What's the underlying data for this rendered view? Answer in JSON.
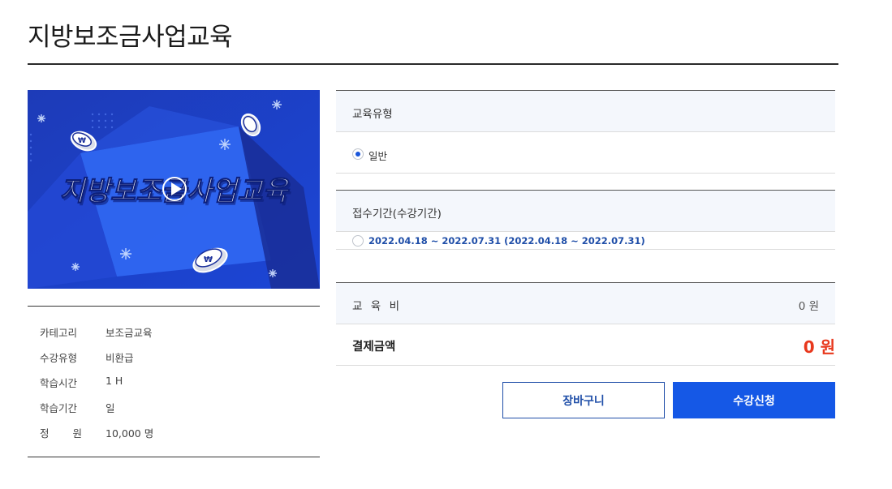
{
  "page": {
    "title": "지방보조금사업교육"
  },
  "thumbnail": {
    "banner_text": "지방보조금사업교육",
    "coin_symbol": "₩"
  },
  "info": {
    "rows": [
      {
        "label": "카테고리",
        "value": "보조금교육"
      },
      {
        "label": "수강유형",
        "value": "비환급"
      },
      {
        "label": "학습시간",
        "value": "1 H"
      },
      {
        "label": "학습기간",
        "value": "일"
      },
      {
        "label_chars": [
          "정",
          "원"
        ],
        "value": "10,000 명"
      }
    ]
  },
  "education_type": {
    "header": "교육유형",
    "options": [
      {
        "label": "일반",
        "checked": true
      }
    ]
  },
  "registration_period": {
    "header": "접수기간(수강기간)",
    "options": [
      {
        "label": "2022.04.18 ~ 2022.07.31 (2022.04.18 ~ 2022.07.31)",
        "checked": false
      }
    ]
  },
  "fee": {
    "label_chars": [
      "교",
      "육",
      "비"
    ],
    "value": "0 원"
  },
  "payment": {
    "label": "결제금액",
    "value": "0 원"
  },
  "buttons": {
    "cart": "장바구니",
    "apply": "수강신청"
  },
  "colors": {
    "accent": "#1558e6",
    "price": "#e8381d",
    "banner_bg": "#1c3cc0",
    "header_bg": "#f4f7fc"
  }
}
